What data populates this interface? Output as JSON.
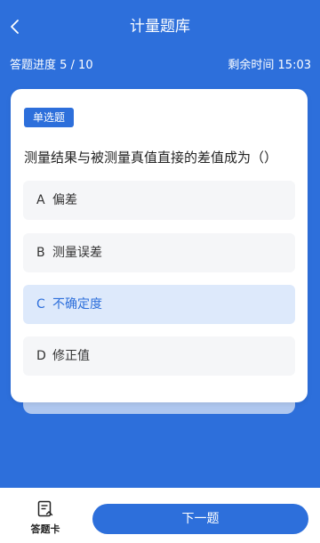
{
  "header": {
    "title": "计量题库",
    "back_icon": "chevron-left-icon"
  },
  "progress": {
    "label": "答题进度 5 / 10",
    "current": 5,
    "total": 10,
    "time_label": "剩余时间 15:03"
  },
  "question": {
    "type_badge": "单选题",
    "text": "测量结果与被测量真值直接的差值成为（）",
    "options": [
      {
        "letter": "A",
        "text": "偏差",
        "selected": false
      },
      {
        "letter": "B",
        "text": "测量误差",
        "selected": false
      },
      {
        "letter": "C",
        "text": "不确定度",
        "selected": true
      },
      {
        "letter": "D",
        "text": "修正值",
        "selected": false
      }
    ]
  },
  "footer": {
    "answer_card_label": "答题卡",
    "answer_card_icon": "answer-sheet-icon",
    "next_label": "下一题"
  },
  "colors": {
    "primary": "#2D6FDB",
    "selected_bg": "#DDE9FB",
    "option_bg": "#F5F6F8"
  }
}
